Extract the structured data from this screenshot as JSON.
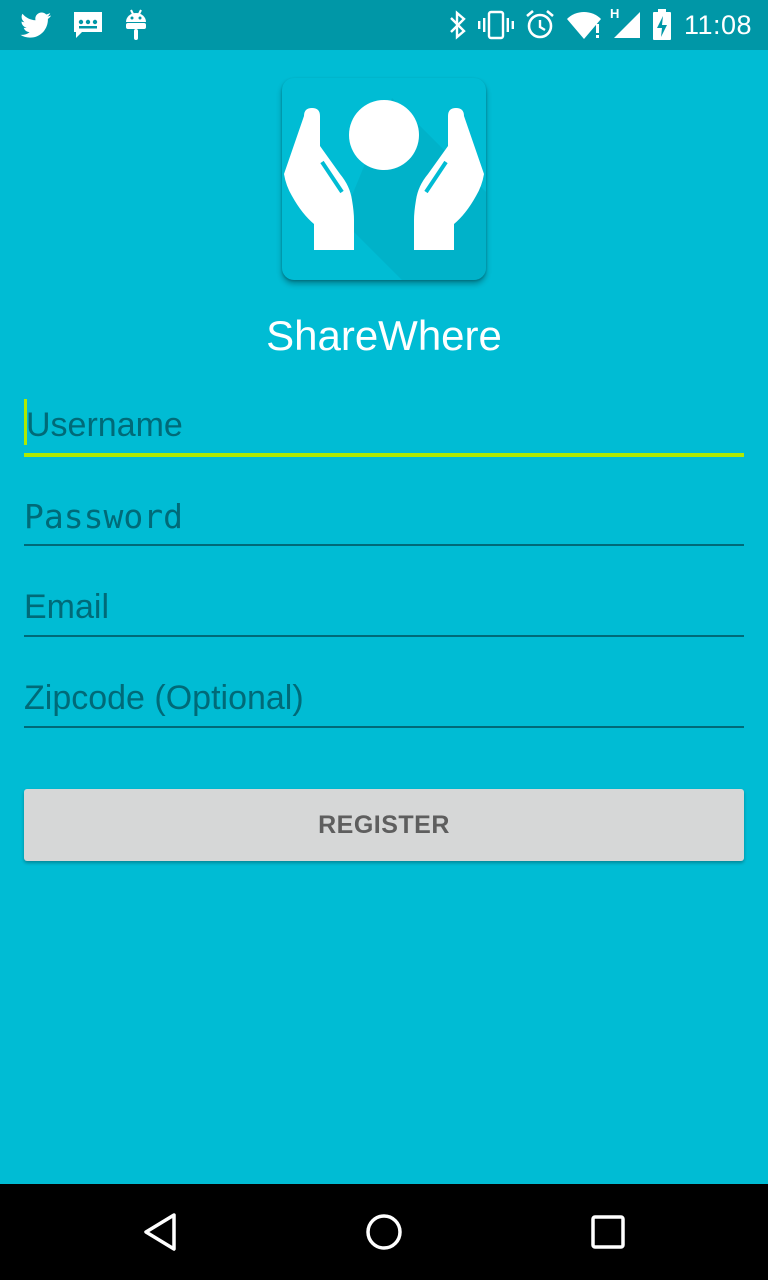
{
  "status_bar": {
    "time": "11:08",
    "network_type": "H",
    "left_icons": [
      "twitter-icon",
      "chat-icon",
      "android-icon"
    ],
    "right_icons": [
      "bluetooth-icon",
      "vibrate-icon",
      "alarm-icon",
      "wifi-icon",
      "cell-signal-icon",
      "battery-charging-icon"
    ]
  },
  "app": {
    "name": "ShareWhere",
    "logo_icon": "hands-holding-circle-icon"
  },
  "form": {
    "username_placeholder": "Username",
    "password_placeholder": "Password",
    "email_placeholder": "Email",
    "zipcode_placeholder": "Zipcode (Optional)",
    "register_label": "REGISTER"
  },
  "nav_bar": {
    "buttons": [
      "back-icon",
      "home-icon",
      "recents-icon"
    ]
  },
  "colors": {
    "background": "#00BCD4",
    "status_bar": "#0097A7",
    "accent": "#AEEA00",
    "hint_text": "#006A78",
    "button_bg": "#D6D7D7"
  }
}
